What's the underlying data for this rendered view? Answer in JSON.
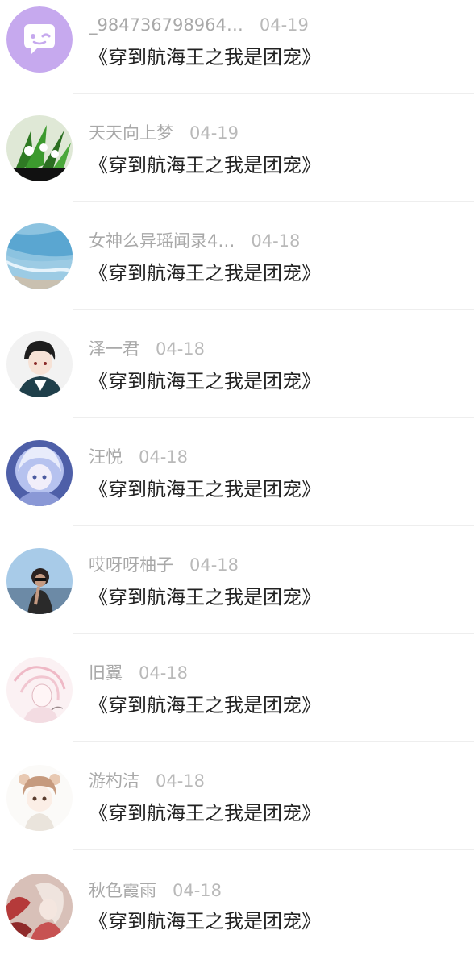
{
  "comments": [
    {
      "user": "_984736798964…",
      "date": "04-19",
      "text": "《穿到航海王之我是团宠》",
      "avatar": "chat-bubble-avatar",
      "avatar_color": "#c6a9ee"
    },
    {
      "user": "天天向上梦",
      "date": "04-19",
      "text": "《穿到航海王之我是团宠》",
      "avatar": "flower-plant-avatar",
      "avatar_color": "#3a8a2e"
    },
    {
      "user": "女神么异瑶闻录4…",
      "date": "04-18",
      "text": "《穿到航海王之我是团宠》",
      "avatar": "sea-shore-avatar",
      "avatar_color": "#7cb8d8"
    },
    {
      "user": "泽一君",
      "date": "04-18",
      "text": "《穿到航海王之我是团宠》",
      "avatar": "anime-boy-avatar",
      "avatar_color": "#2a2a2a"
    },
    {
      "user": "汪悦",
      "date": "04-18",
      "text": "《穿到航海王之我是团宠》",
      "avatar": "anime-girl-blue-avatar",
      "avatar_color": "#6c7fc4"
    },
    {
      "user": "哎呀呀柚子",
      "date": "04-18",
      "text": "《穿到航海王之我是团宠》",
      "avatar": "photo-person-avatar",
      "avatar_color": "#9cc4e4"
    },
    {
      "user": "旧翼",
      "date": "04-18",
      "text": "《穿到航海王之我是团宠》",
      "avatar": "pink-sketch-avatar",
      "avatar_color": "#f3d6dc"
    },
    {
      "user": "游杓洁",
      "date": "04-18",
      "text": "《穿到航海王之我是团宠》",
      "avatar": "chibi-girl-avatar",
      "avatar_color": "#e8d6c2"
    },
    {
      "user": "秋色霞雨",
      "date": "04-18",
      "text": "《穿到航海王之我是团宠》",
      "avatar": "red-floral-avatar",
      "avatar_color": "#b53a3a"
    }
  ]
}
